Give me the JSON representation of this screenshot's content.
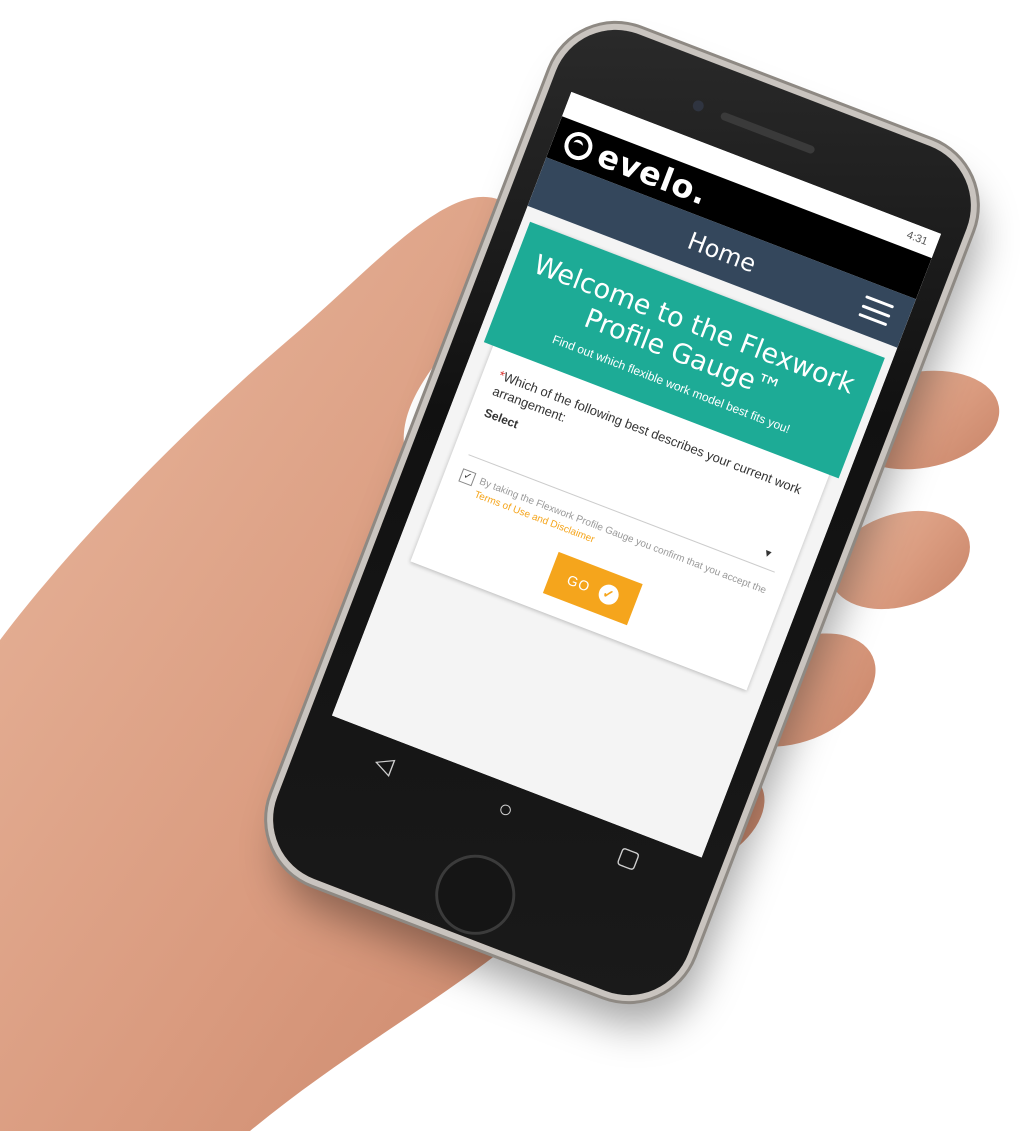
{
  "status": {
    "text": "4:31"
  },
  "brand": {
    "name": "evelo."
  },
  "nav": {
    "title": "Home"
  },
  "hero": {
    "title": "Welcome to the Flexwork Profile Gauge™",
    "subtitle": "Find out which flexible work model best fits you!"
  },
  "form": {
    "required_mark": "*",
    "question": "Which of the following best describes your current work arrangement:",
    "select_label": "Select",
    "select_arrow": "▾",
    "checkbox_mark": "✓",
    "agree_text": "By taking the Flexwork Profile Gauge you confirm that you accept the",
    "agree_link": "Terms of Use and Disclaimer",
    "go_label": "GO",
    "go_icon": "check-icon"
  },
  "softkeys": {
    "back": "◁",
    "home": "○",
    "recents": "▢"
  },
  "colors": {
    "teal": "#1dab96",
    "navbar": "#34475c",
    "accent": "#f5a51c"
  }
}
